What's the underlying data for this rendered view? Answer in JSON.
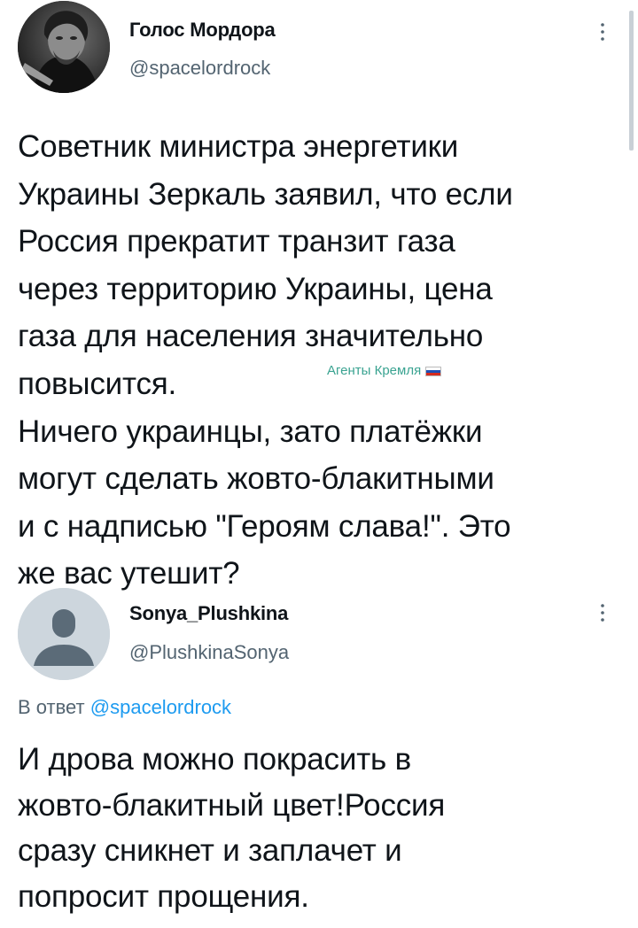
{
  "tweet1": {
    "display_name": "Голос Мордора",
    "handle": "@spacelordrock",
    "text_lines": [
      "Советник министра энергетики",
      "Украины Зеркаль заявил, что если",
      "Россия прекратит транзит газа",
      "через территорию Украины, цена",
      "газа для населения значительно",
      "повысится.",
      "Ничего украинцы, зато платёжки",
      "могут сделать жовто-блакитными",
      "и с надписью \"Героям слава!\". Это",
      "же вас утешит?"
    ],
    "watermark": "Агенты Кремля",
    "more_icon": "more-vertical-icon"
  },
  "tweet2": {
    "display_name": "Sonya_Plushkina",
    "handle": "@PlushkinaSonya",
    "reply_prefix": "В ответ",
    "reply_handle": "@spacelordrock",
    "text_lines": [
      "И дрова можно покрасить в",
      "жовто-блакитный цвет!Россия",
      "сразу сникнет и заплачет и",
      "попросит прощения."
    ],
    "more_icon": "more-vertical-icon"
  },
  "colors": {
    "text": "#0f1419",
    "secondary": "#536471",
    "link": "#1d9bf0",
    "watermark": "#3aa391"
  }
}
